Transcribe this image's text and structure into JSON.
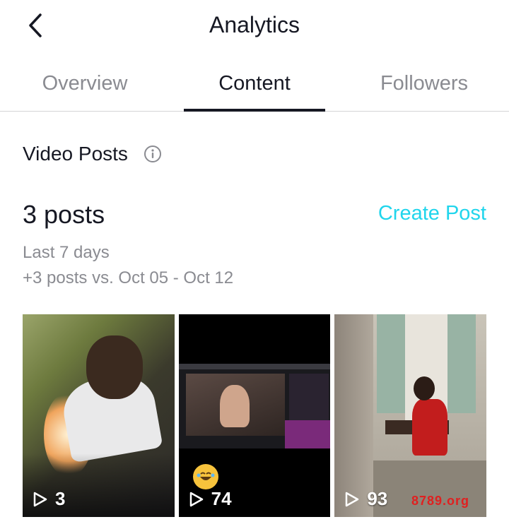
{
  "header": {
    "title": "Analytics",
    "back_icon": "chevron-left-icon"
  },
  "tabs": [
    {
      "label": "Overview",
      "active": false
    },
    {
      "label": "Content",
      "active": true
    },
    {
      "label": "Followers",
      "active": false
    }
  ],
  "section": {
    "title": "Video Posts",
    "info_icon": "info-icon"
  },
  "summary": {
    "posts_count": "3 posts",
    "create_post_label": "Create Post",
    "period": "Last 7 days",
    "comparison": "+3 posts vs. Oct 05 - Oct 12"
  },
  "videos": [
    {
      "views": "3"
    },
    {
      "views": "74"
    },
    {
      "views": "93"
    }
  ],
  "watermark": "8789.org",
  "colors": {
    "accent": "#20d5ec",
    "text": "#161823",
    "muted": "#8a8b91"
  }
}
